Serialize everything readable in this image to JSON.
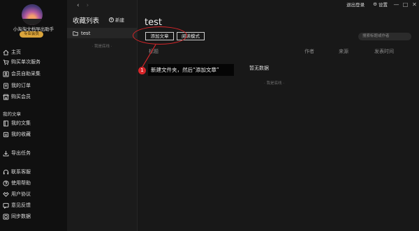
{
  "window": {
    "logout": "退出登录",
    "settings": "设置",
    "minimize": "—",
    "maximize": "□",
    "close": "✕"
  },
  "sidebar": {
    "username": "小淘淘文档导出助手",
    "badge": "专业会员",
    "items_top": [
      {
        "label": "主页",
        "icon": "home-icon"
      },
      {
        "label": "购买单次服务",
        "icon": "cart-icon"
      },
      {
        "label": "会员自助采集",
        "icon": "user-icon"
      },
      {
        "label": "我的订单",
        "icon": "order-icon"
      },
      {
        "label": "购买会员",
        "icon": "shop-icon"
      }
    ],
    "section_articles": "我的文章",
    "items_articles": [
      {
        "label": "我的文集",
        "icon": "book-icon"
      },
      {
        "label": "我的收藏",
        "icon": "bookmark-icon"
      }
    ],
    "export": {
      "label": "导出任务",
      "icon": "download-icon"
    },
    "items_bottom": [
      {
        "label": "联系客服",
        "icon": "headset-icon"
      },
      {
        "label": "使用帮助",
        "icon": "help-icon"
      },
      {
        "label": "用户协议",
        "icon": "agreement-icon"
      },
      {
        "label": "意见反馈",
        "icon": "feedback-icon"
      },
      {
        "label": "同步数据",
        "icon": "sync-icon"
      }
    ]
  },
  "folders": {
    "title": "收藏列表",
    "new_label": "新建",
    "items": [
      {
        "label": "test"
      }
    ],
    "end_text": "· 我是底线 ·"
  },
  "main": {
    "title": "test",
    "add_button": "添加文章",
    "read_button": "阅读模式",
    "search_placeholder": "搜索标题或作者",
    "columns": {
      "title": "标题",
      "author": "作者",
      "source": "来源",
      "time": "发表时间"
    },
    "empty": "暂无数据",
    "end_text": "· 我是底线 ·"
  },
  "annotation": {
    "number": "1",
    "text": "新建文件夹，然后“添加文章”",
    "color": "#d7262a"
  }
}
